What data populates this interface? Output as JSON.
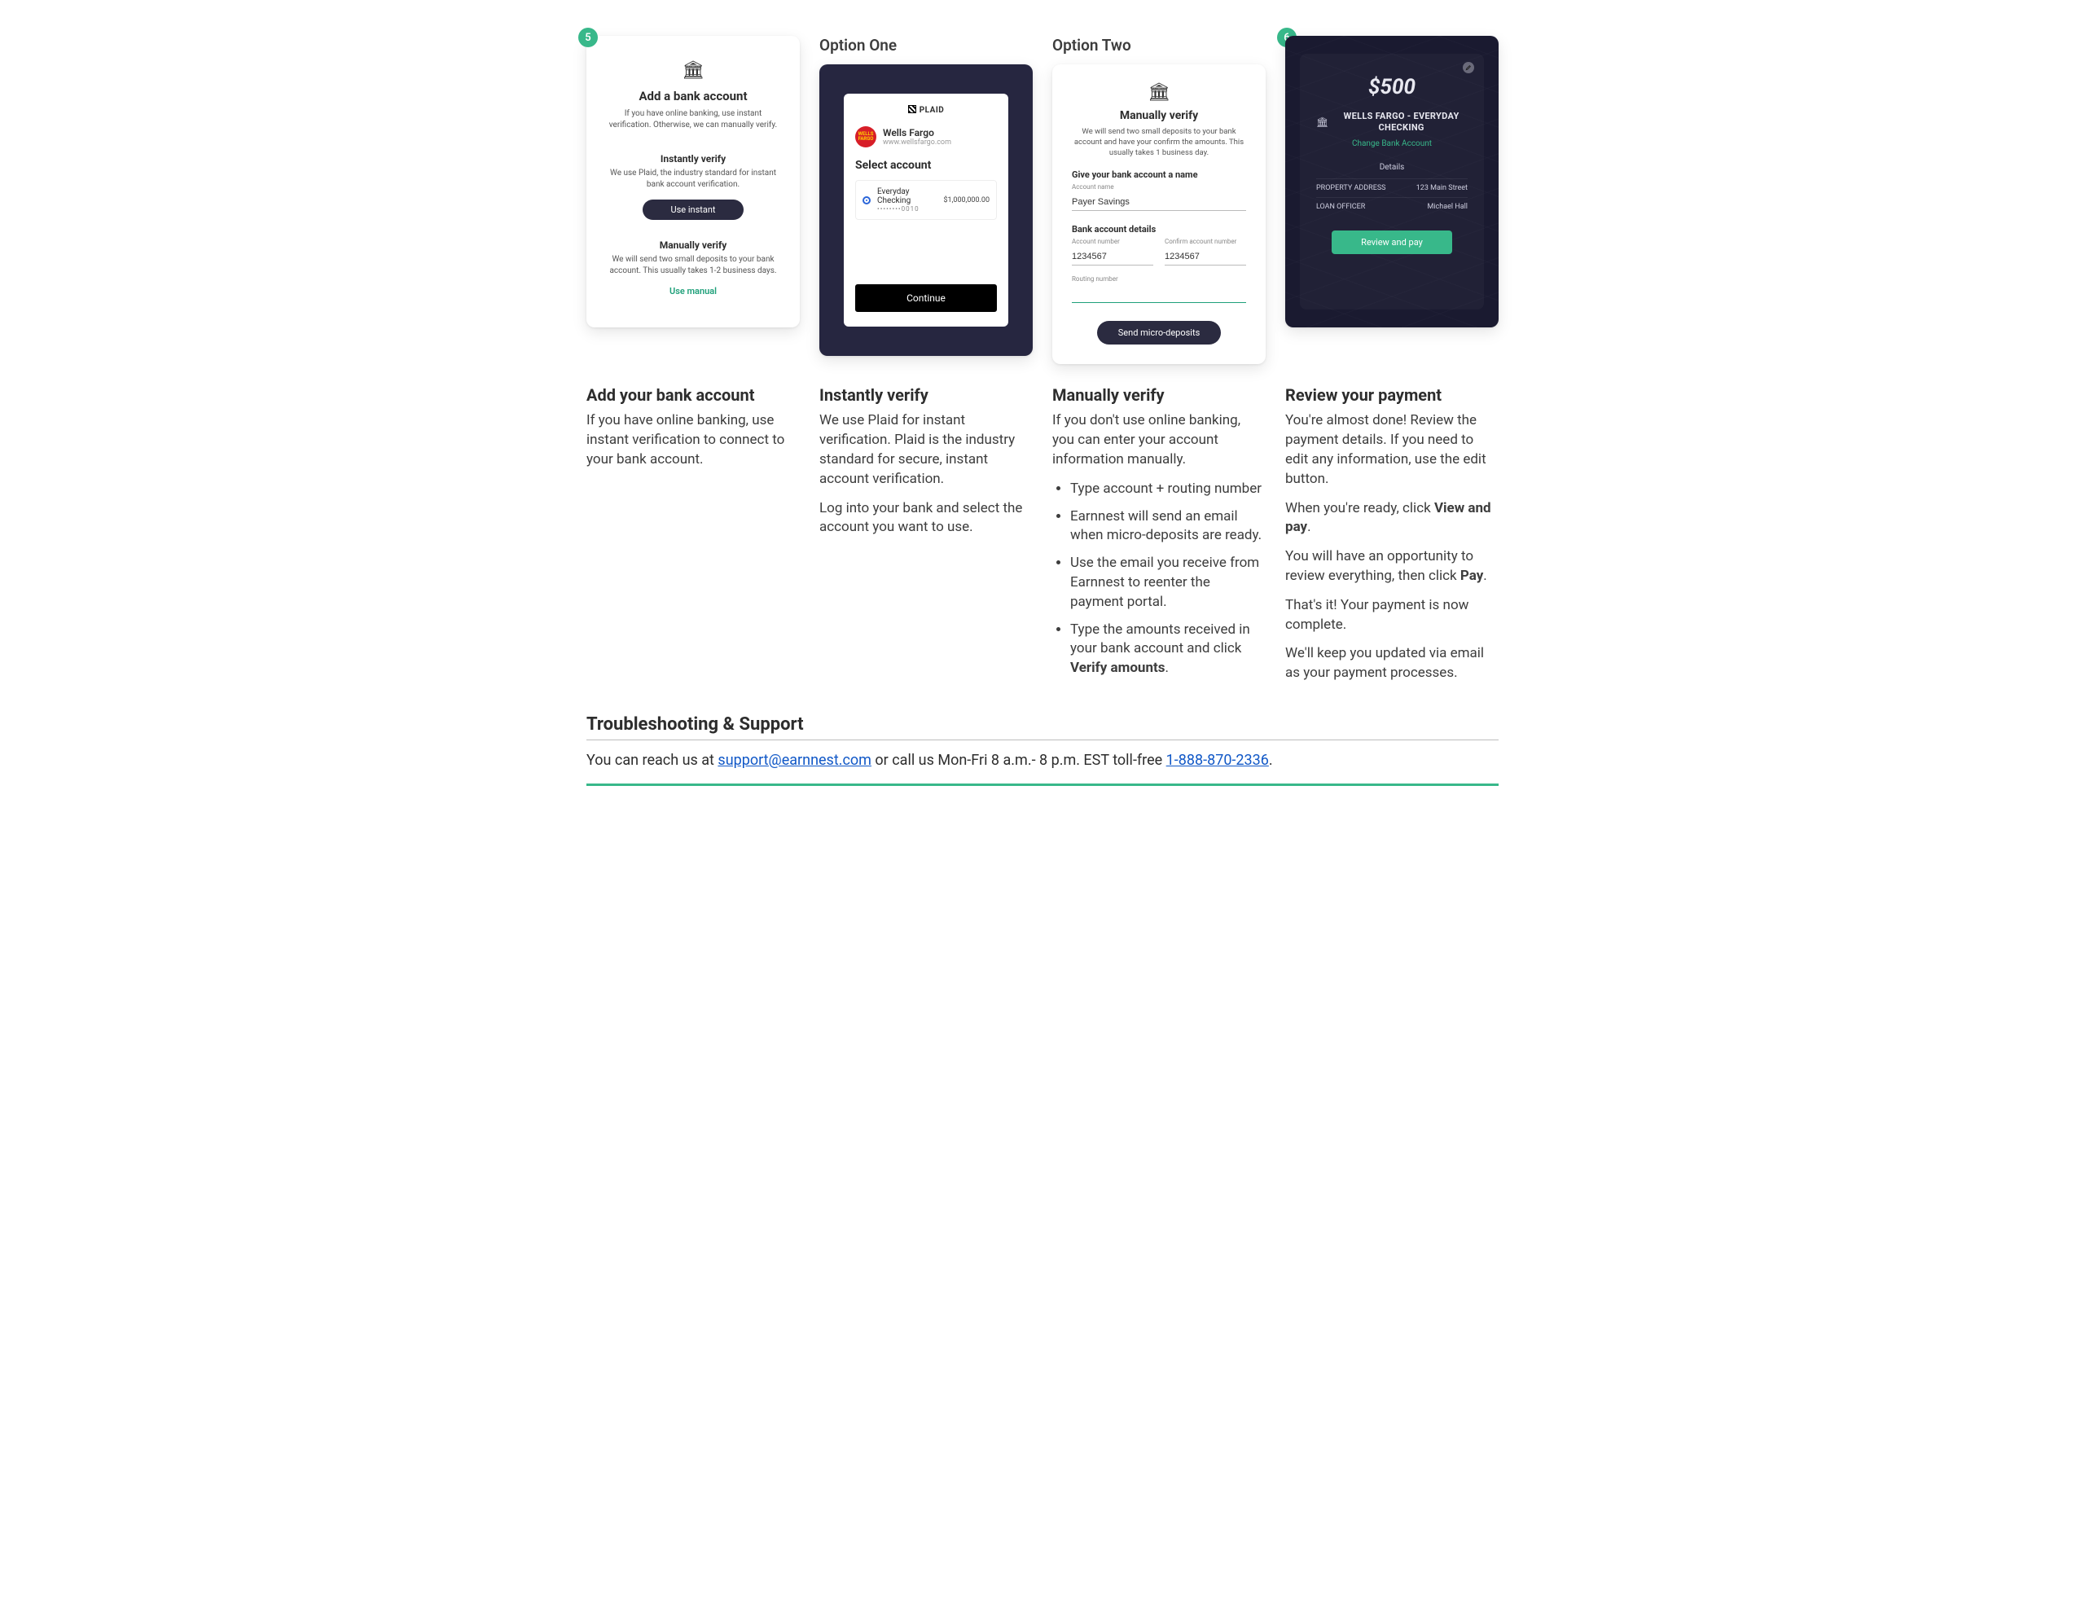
{
  "step5": {
    "badge": "5",
    "card": {
      "title": "Add a bank account",
      "subtitle": "If you have online banking, use instant verification. Otherwise, we can manually verify.",
      "instant": {
        "title": "Instantly verify",
        "desc": "We use Plaid, the industry standard for instant bank account verification.",
        "button": "Use instant"
      },
      "manual": {
        "title": "Manually verify",
        "desc": "We will send two small deposits to your bank account. This usually takes 1-2 business days.",
        "link": "Use manual"
      }
    },
    "desc": {
      "title": "Add your bank account",
      "body": "If you have online banking, use instant verification to connect to your bank account."
    }
  },
  "option1": {
    "label": "Option One",
    "plaid": {
      "logo": "PLAID",
      "bank_name": "Wells Fargo",
      "bank_url": "www.wellsfargo.com",
      "select": "Select account",
      "account_name": "Everyday Checking",
      "account_mask": "••••••••0010",
      "account_balance": "$1,000,000.00",
      "continue": "Continue"
    },
    "desc": {
      "title": "Instantly verify",
      "body1": "We use Plaid for instant verification. Plaid is the industry standard for secure, instant account verification.",
      "body2": "Log into your bank and select the account you want to use."
    }
  },
  "option2": {
    "label": "Option Two",
    "card": {
      "title": "Manually verify",
      "desc": "We will send two small deposits to your bank account and have your confirm the amounts. This usually takes 1 business day.",
      "name_label": "Give your bank account a name",
      "name_placeholder": "Account name",
      "name_value": "Payer Savings",
      "details_label": "Bank account details",
      "acct_label": "Account number",
      "acct_value": "1234567",
      "confirm_label": "Confirm account number",
      "confirm_value": "1234567",
      "routing_label": "Routing number",
      "routing_value": "",
      "button": "Send micro-deposits"
    },
    "desc": {
      "title": "Manually verify",
      "body": "If you don't use online banking, you can enter your account information manually.",
      "bullets": {
        "b1": "Type account + routing number",
        "b2": "Earnnest will send an email when micro-deposits are ready.",
        "b3": "Use the email you receive from Earnnest to reenter the payment portal.",
        "b4a": "Type the amounts received in your bank account and click ",
        "b4b": "Verify amounts",
        "b4c": "."
      }
    }
  },
  "step6": {
    "badge": "6",
    "card": {
      "amount": "$500",
      "bank": "WELLS FARGO - EVERYDAY CHECKING",
      "change": "Change Bank Account",
      "details_hdr": "Details",
      "rows": {
        "addr_label": "PROPERTY ADDRESS",
        "addr_value": "123 Main Street",
        "lo_label": "LOAN OFFICER",
        "lo_value": "Michael Hall"
      },
      "button": "Review and pay"
    },
    "desc": {
      "title": "Review your payment",
      "p1": "You're almost done! Review the payment details. If you need to edit any information, use the edit button.",
      "p2a": "When you're ready, click ",
      "p2b": "View and pay",
      "p2c": ".",
      "p3a": "You will have an opportunity to review everything, then click ",
      "p3b": "Pay",
      "p3c": ".",
      "p4": "That's it! Your payment is now complete.",
      "p5": "We'll keep you updated via email as your payment processes."
    }
  },
  "trouble": {
    "heading": "Troubleshooting & Support",
    "pre": "You can reach us at ",
    "email": "support@earnnest.com",
    "mid": " or call us Mon-Fri 8 a.m.- 8 p.m. EST toll-free ",
    "phone": "1-888-870-2336",
    "post": "."
  }
}
